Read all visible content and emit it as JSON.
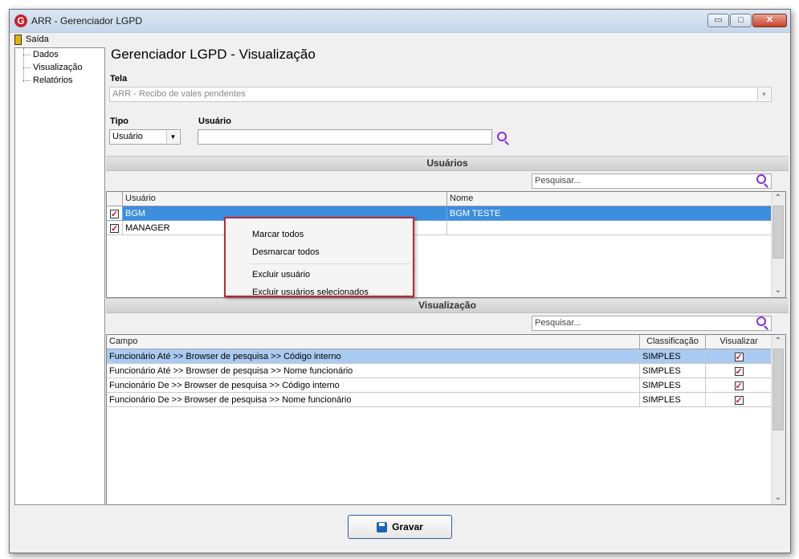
{
  "window": {
    "title": "ARR - Gerenciador LGPD",
    "logo": "G"
  },
  "window_controls": {
    "minimize": "▭",
    "maximize": "□",
    "close": "✕"
  },
  "menubar": {
    "exit_label": "Saída"
  },
  "tree": {
    "items": [
      "Dados",
      "Visualização",
      "Relatórios"
    ]
  },
  "page_title": "Gerenciador LGPD - Visualização",
  "tela": {
    "label": "Tela",
    "value": "ARR - Recibo de vales pendentes"
  },
  "tipo": {
    "label": "Tipo",
    "value": "Usuário"
  },
  "usuario_field": {
    "label": "Usuário",
    "value": ""
  },
  "usuarios_section": {
    "title": "Usuários",
    "search_placeholder": "Pesquisar...",
    "columns": [
      "Usuário",
      "Nome"
    ],
    "rows": [
      {
        "checked": true,
        "usuario": "BGM",
        "nome": "BGM TESTE"
      },
      {
        "checked": true,
        "usuario": "MANAGER",
        "nome": ""
      }
    ]
  },
  "context_menu": {
    "items": [
      "Marcar todos",
      "Desmarcar todos",
      "Excluir usuário",
      "Excluir usuários selecionados"
    ]
  },
  "visualizacao_section": {
    "title": "Visualização",
    "search_placeholder": "Pesquisar...",
    "columns": [
      "Campo",
      "Classificação",
      "Visualizar"
    ],
    "rows": [
      {
        "campo": "Funcionário Até >> Browser de pesquisa >> Código interno",
        "classificacao": "SIMPLES",
        "visualizar": true
      },
      {
        "campo": "Funcionário Até >> Browser de pesquisa >> Nome funcionário",
        "classificacao": "SIMPLES",
        "visualizar": true
      },
      {
        "campo": "Funcionário De >> Browser de pesquisa >> Código interno",
        "classificacao": "SIMPLES",
        "visualizar": true
      },
      {
        "campo": "Funcionário De >> Browser de pesquisa >> Nome funcionário",
        "classificacao": "SIMPLES",
        "visualizar": true
      }
    ]
  },
  "footer": {
    "save_label": "Gravar"
  },
  "colors": {
    "selection": "#3c8edf",
    "context_border": "#c4262e",
    "search_icon": "#8a2be2",
    "check": "#d1102a"
  }
}
